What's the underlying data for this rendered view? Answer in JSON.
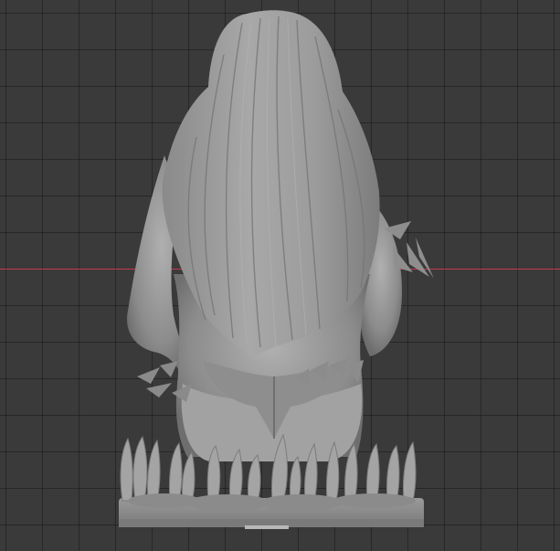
{
  "viewport": {
    "background": "#3a3a3a",
    "grid_color": "#262626",
    "x_axis_color": "#c4394d",
    "model_color": "#9a9a9a"
  },
  "scene": {
    "object": "sculpted-bust-back-view",
    "shading": "solid-gray"
  }
}
